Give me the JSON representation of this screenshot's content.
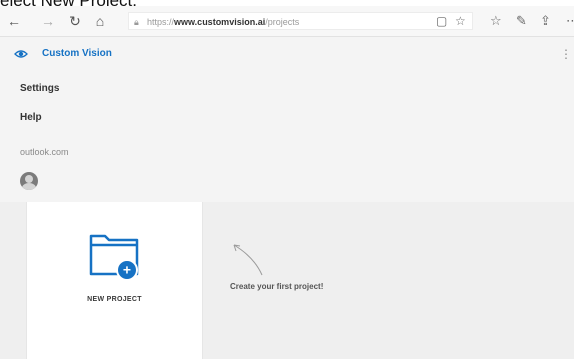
{
  "caption": "elect New Project.",
  "browser": {
    "back_icon": "←",
    "forward_icon": "→",
    "refresh_icon": "↻",
    "home_icon": "⌂",
    "url_prefix": "https://",
    "url_domain": "www.customvision.ai",
    "url_path": "/projects"
  },
  "app": {
    "title": "Custom Vision",
    "accent": "#1672c4"
  },
  "menu": {
    "settings": "Settings",
    "help": "Help",
    "account": "outlook.com"
  },
  "main": {
    "new_project_label": "NEW PROJECT",
    "hint": "Create your first project!",
    "plus": "+"
  }
}
